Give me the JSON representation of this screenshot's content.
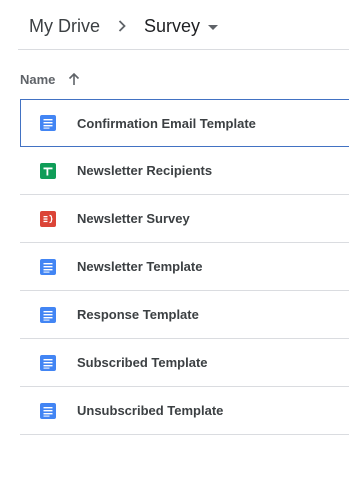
{
  "breadcrumb": {
    "root": "My Drive",
    "current": "Survey"
  },
  "list_header": {
    "name_label": "Name",
    "sort_direction": "ascending"
  },
  "files": [
    {
      "name": "Confirmation Email Template",
      "type": "doc",
      "selected": true
    },
    {
      "name": "Newsletter Recipients",
      "type": "sheet",
      "selected": false
    },
    {
      "name": "Newsletter Survey",
      "type": "form",
      "selected": false
    },
    {
      "name": "Newsletter Template",
      "type": "doc",
      "selected": false
    },
    {
      "name": "Response Template",
      "type": "doc",
      "selected": false
    },
    {
      "name": "Subscribed Template",
      "type": "doc",
      "selected": false
    },
    {
      "name": "Unsubscribed Template",
      "type": "doc",
      "selected": false
    }
  ],
  "colors": {
    "doc": "#4285f4",
    "sheet": "#0f9d58",
    "form": "#db4437",
    "selection_border": "#4272c3"
  }
}
